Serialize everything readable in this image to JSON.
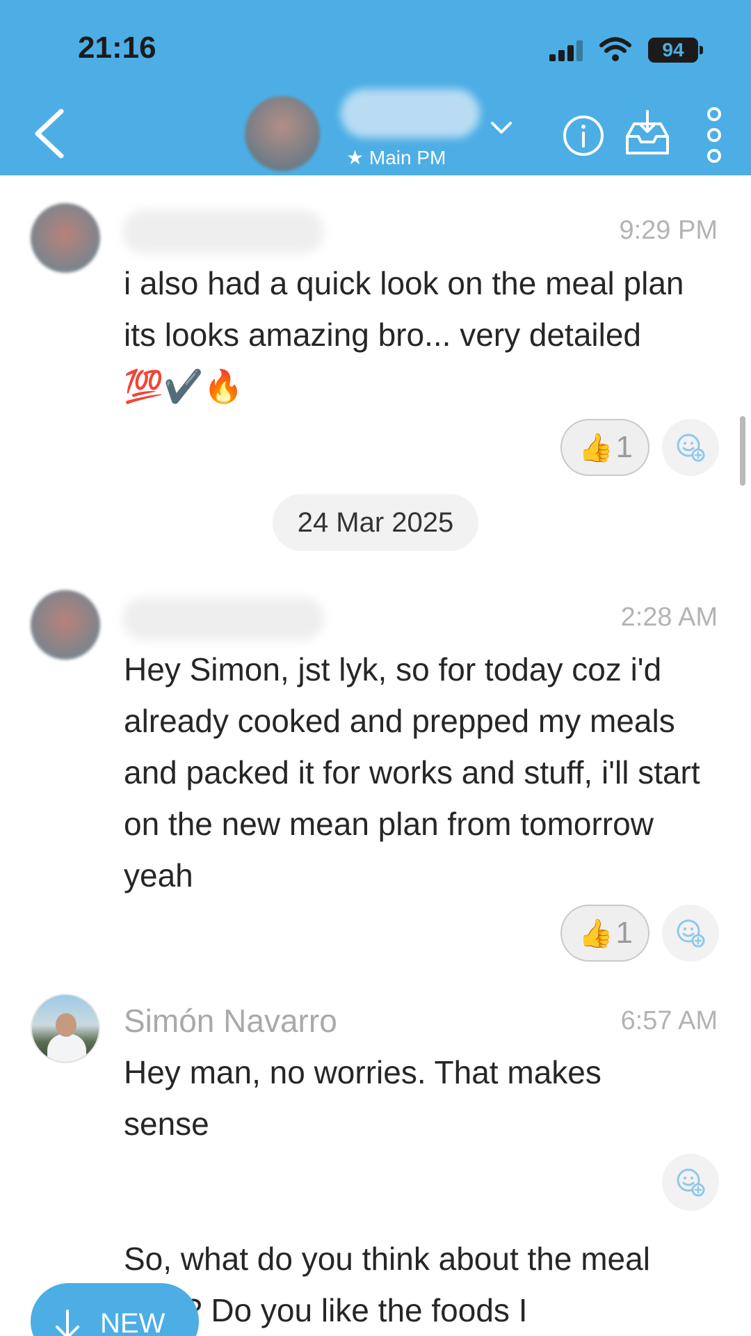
{
  "status_bar": {
    "time": "21:16",
    "battery": "94"
  },
  "header": {
    "subtitle": "★ Main PM"
  },
  "messages": [
    {
      "time": "9:29 PM",
      "text": "i also had a quick look on the meal plan its looks amazing bro... very detailed 💯✔️🔥",
      "reaction": {
        "emoji": "👍",
        "count": "1"
      }
    },
    {
      "time": "2:28 AM",
      "text": "Hey Simon, jst lyk, so for today coz i'd already cooked and prepped my meals and packed it for works and stuff, i'll start on the new mean plan from tomorrow yeah",
      "reaction": {
        "emoji": "👍",
        "count": "1"
      }
    },
    {
      "sender": "Simón Navarro",
      "time": "6:57 AM",
      "text": "Hey man, no worries. That makes sense"
    },
    {
      "text": "So, what do you think about the meal plan? Do you like the foods I"
    }
  ],
  "date_separator": "24 Mar 2025",
  "new_button": {
    "label": "NEW"
  },
  "colors": {
    "accent": "#4caee5",
    "meta_text": "#b3b3b3"
  }
}
